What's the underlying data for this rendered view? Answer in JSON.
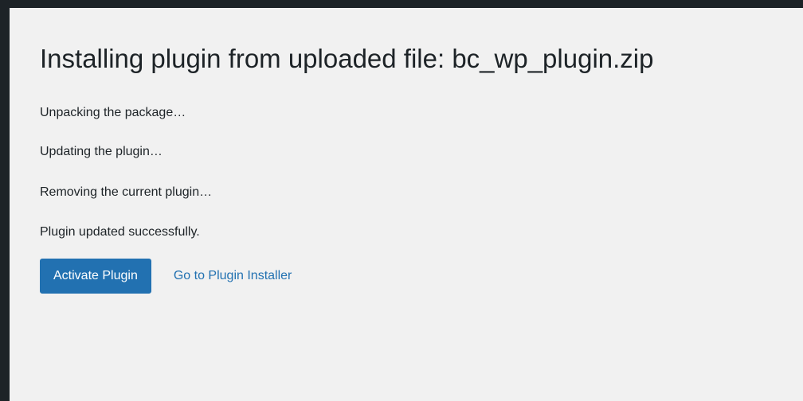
{
  "page": {
    "title": "Installing plugin from uploaded file: bc_wp_plugin.zip"
  },
  "log": {
    "lines": [
      "Unpacking the package…",
      "Updating the plugin…",
      "Removing the current plugin…",
      "Plugin updated successfully."
    ]
  },
  "actions": {
    "activate_label": "Activate Plugin",
    "installer_link_label": "Go to Plugin Installer"
  },
  "colors": {
    "frame": "#1d2327",
    "background": "#f1f1f1",
    "primary": "#2271b1",
    "text": "#1d2327"
  }
}
